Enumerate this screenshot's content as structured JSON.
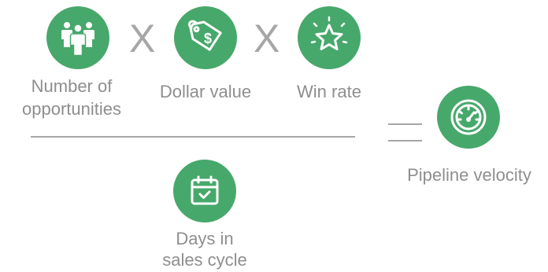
{
  "factors": {
    "opportunities": {
      "line1": "Number of",
      "line2": "opportunities",
      "icon": "people-icon"
    },
    "dollar": {
      "label": "Dollar value",
      "icon": "price-tag-icon"
    },
    "winrate": {
      "label": "Win rate",
      "icon": "star-icon"
    }
  },
  "operator_multiply": "X",
  "divisor": {
    "line1": "Days in",
    "line2": "sales cycle",
    "icon": "calendar-icon"
  },
  "result": {
    "label": "Pipeline velocity",
    "icon": "speedometer-icon"
  },
  "colors": {
    "accent": "#47a86b",
    "text": "#8e8e8e",
    "line": "#a6a6a6"
  }
}
